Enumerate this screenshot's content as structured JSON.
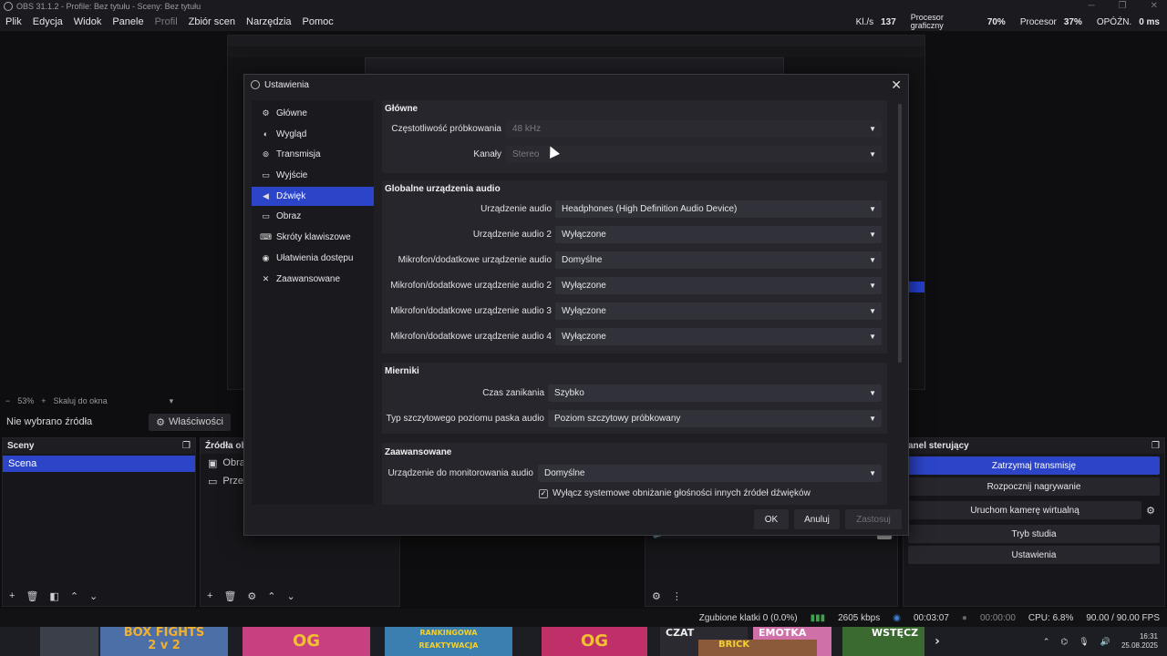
{
  "window": {
    "title": "OBS 31.1.2 - Profile: Bez tytułu - Sceny: Bez tytułu"
  },
  "menu": [
    "Plik",
    "Edycja",
    "Widok",
    "Panele",
    "Profil",
    "Zbiór scen",
    "Narzędzia",
    "Pomoc"
  ],
  "stats": {
    "fps_label": "Kl./s",
    "fps_value": "137",
    "gpu_label_1": "Procesor",
    "gpu_label_2": "graficzny",
    "gpu_value": "70%",
    "cpu_label": "Procesor",
    "cpu_value": "37%",
    "delay_label": "OPÓŹN.",
    "delay_value": "0 ms"
  },
  "preview": {
    "zoom": "53%",
    "fit": "Skaluj do okna"
  },
  "source_bar": {
    "no_source": "Nie wybrano źródła",
    "properties": "Właściwości"
  },
  "scenes": {
    "title": "Sceny",
    "items": [
      "Scena"
    ]
  },
  "sources": {
    "title": "Źródła ob",
    "items": [
      {
        "label": "Obraz",
        "icon": "image-icon"
      },
      {
        "label": "Przec",
        "icon": "monitor-icon"
      }
    ]
  },
  "controls": {
    "title": "anel sterujący",
    "buttons": [
      {
        "label": "Zatrzymaj transmisję",
        "active": true
      },
      {
        "label": "Rozpocznij nagrywanie",
        "active": false
      },
      {
        "label": "Uruchom kamerę wirtualną",
        "active": false
      },
      {
        "label": "Tryb studia",
        "active": false
      },
      {
        "label": "Ustawienia",
        "active": false
      }
    ]
  },
  "statusbar": {
    "dropped": "Zgubione klatki 0 (0.0%)",
    "bitrate": "2605 kbps",
    "stream_time": "00:03:07",
    "rec_time": "00:00:00",
    "cpu": "CPU: 6.8%",
    "fps": "90.00 / 90.00 FPS"
  },
  "taskbar": {
    "thumbs": [
      "BOX FIGHTS",
      "2 v 2",
      "OG",
      "RANKINGOWA",
      "REAKTYWACJA",
      "OG",
      "CZAT",
      "EMOTKA",
      "BRICK",
      "WSTĘCZ"
    ],
    "time": "16:31",
    "date": "25.08.2025"
  },
  "dialog": {
    "title": "Ustawienia",
    "nav": [
      {
        "label": "Główne",
        "icon": "gear-icon"
      },
      {
        "label": "Wygląd",
        "icon": "palette-icon"
      },
      {
        "label": "Transmisja",
        "icon": "antenna-icon"
      },
      {
        "label": "Wyjście",
        "icon": "output-icon"
      },
      {
        "label": "Dźwięk",
        "icon": "speaker-icon"
      },
      {
        "label": "Obraz",
        "icon": "monitor-icon"
      },
      {
        "label": "Skróty klawiszowe",
        "icon": "keyboard-icon"
      },
      {
        "label": "Ułatwienia dostępu",
        "icon": "accessibility-icon"
      },
      {
        "label": "Zaawansowane",
        "icon": "tools-icon"
      }
    ],
    "selected_nav": "Dźwięk",
    "groups": {
      "general": {
        "title": "Główne",
        "sample_rate_label": "Częstotliwość próbkowania",
        "sample_rate_value": "48 kHz",
        "channels_label": "Kanały",
        "channels_value": "Stereo"
      },
      "global_devices": {
        "title": "Globalne urządzenia audio",
        "rows": [
          {
            "label": "Urządzenie audio",
            "value": "Headphones (High Definition Audio Device)"
          },
          {
            "label": "Urządzenie audio 2",
            "value": "Wyłączone"
          },
          {
            "label": "Mikrofon/dodatkowe urządzenie audio",
            "value": "Domyślne"
          },
          {
            "label": "Mikrofon/dodatkowe urządzenie audio 2",
            "value": "Wyłączone"
          },
          {
            "label": "Mikrofon/dodatkowe urządzenie audio 3",
            "value": "Wyłączone"
          },
          {
            "label": "Mikrofon/dodatkowe urządzenie audio 4",
            "value": "Wyłączone"
          }
        ]
      },
      "meters": {
        "title": "Mierniki",
        "decay_label": "Czas zanikania",
        "decay_value": "Szybko",
        "peak_label": "Typ szczytowego poziomu paska audio",
        "peak_value": "Poziom szczytowy próbkowany"
      },
      "advanced": {
        "title": "Zaawansowane",
        "monitor_label": "Urządzenie do monitorowania audio",
        "monitor_value": "Domyślne",
        "ducking_label": "Wyłącz systemowe obniżanie głośności innych źródeł dźwięków",
        "ducking_checked": true
      }
    },
    "buttons": {
      "ok": "OK",
      "cancel": "Anuluj",
      "apply": "Zastosuj"
    }
  }
}
